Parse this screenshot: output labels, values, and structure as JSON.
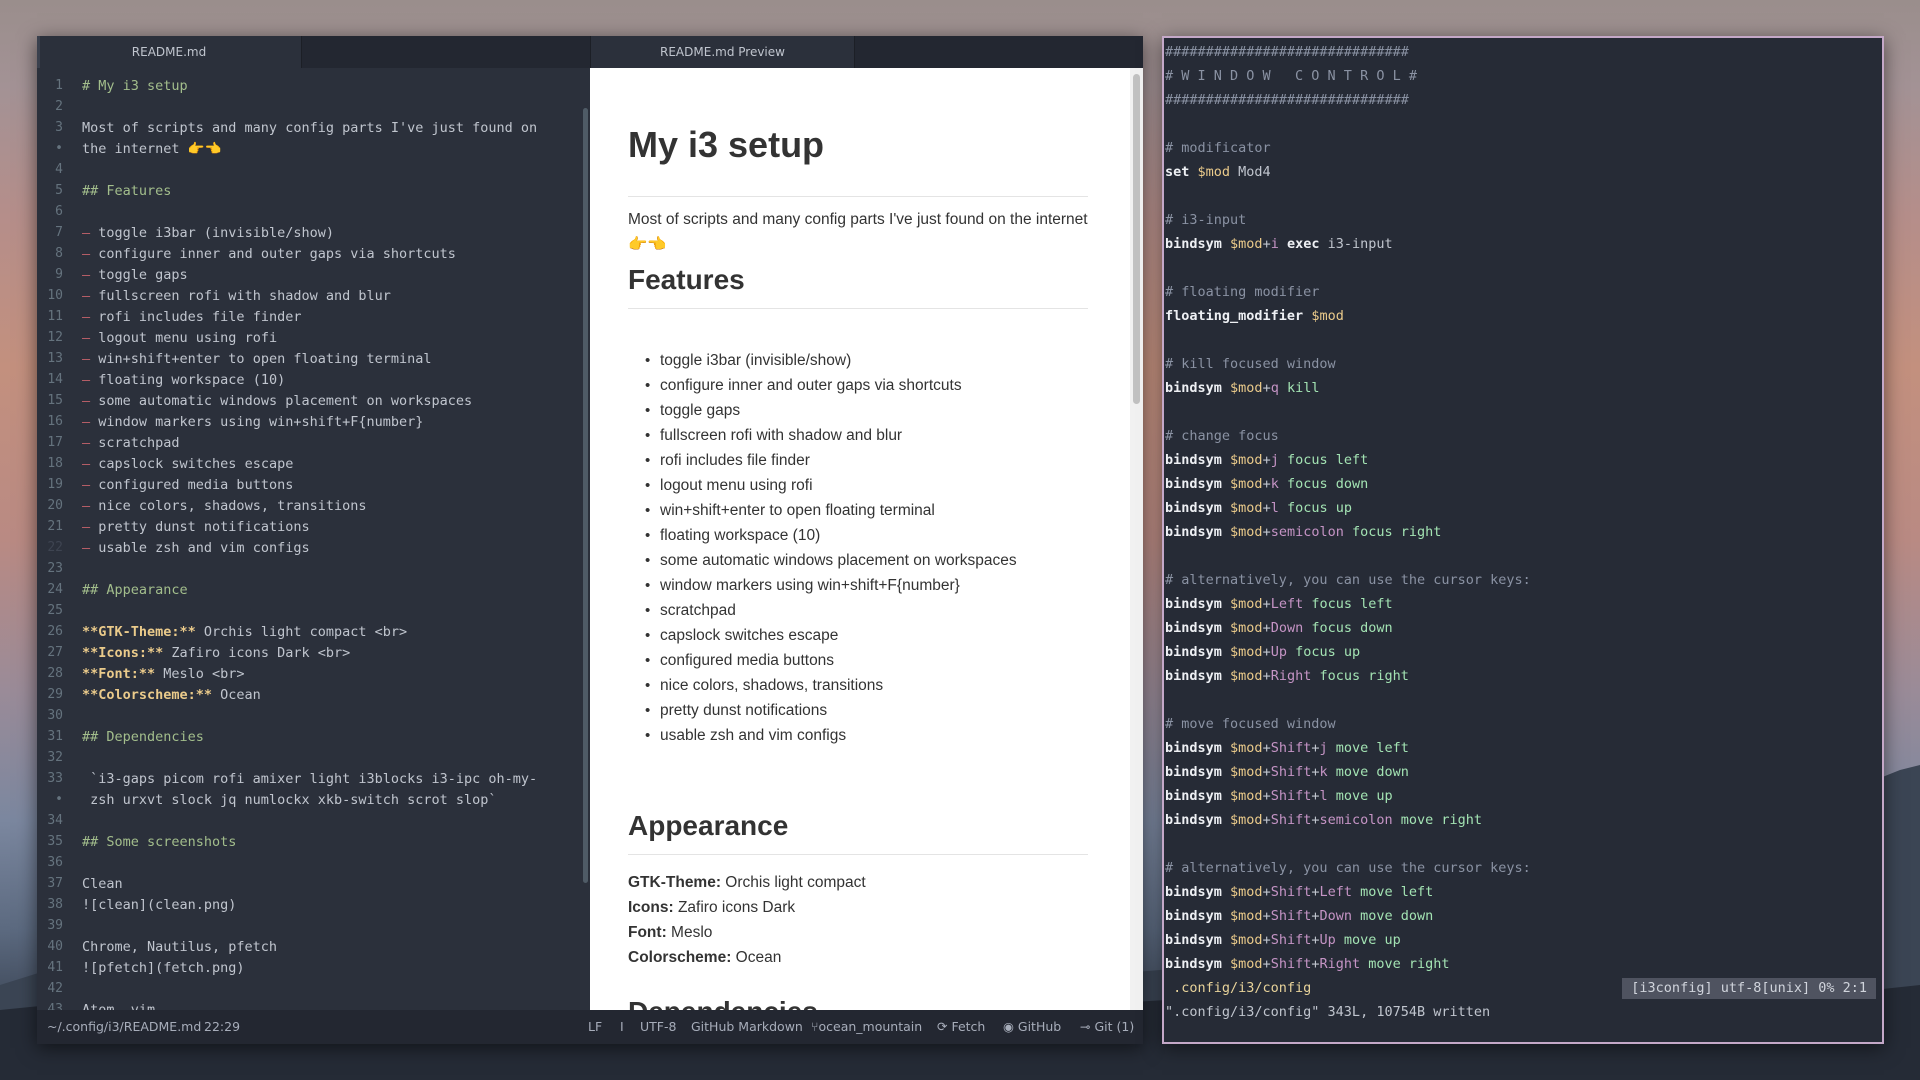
{
  "atom": {
    "tabs": [
      "README.md",
      "README.md Preview"
    ],
    "editor_lines": [
      {
        "n": "1",
        "text": "# My i3 setup",
        "kind": "h"
      },
      {
        "n": "2",
        "text": "",
        "kind": ""
      },
      {
        "n": "3",
        "text": "Most of scripts and many config parts I've just found on",
        "kind": ""
      },
      {
        "n": "•",
        "text": "the internet 👉👈",
        "kind": ""
      },
      {
        "n": "4",
        "text": "",
        "kind": ""
      },
      {
        "n": "5",
        "text": "## Features",
        "kind": "h"
      },
      {
        "n": "6",
        "text": "",
        "kind": ""
      },
      {
        "n": "7",
        "text": "toggle i3bar (invisible/show)",
        "kind": "li"
      },
      {
        "n": "8",
        "text": "configure inner and outer gaps via shortcuts",
        "kind": "li"
      },
      {
        "n": "9",
        "text": "toggle gaps",
        "kind": "li"
      },
      {
        "n": "10",
        "text": "fullscreen rofi with shadow and blur",
        "kind": "li"
      },
      {
        "n": "11",
        "text": "rofi includes file finder",
        "kind": "li"
      },
      {
        "n": "12",
        "text": "logout menu using rofi",
        "kind": "li"
      },
      {
        "n": "13",
        "text": "win+shift+enter to open floating terminal",
        "kind": "li"
      },
      {
        "n": "14",
        "text": "floating workspace (10)",
        "kind": "li"
      },
      {
        "n": "15",
        "text": "some automatic windows placement on workspaces",
        "kind": "li"
      },
      {
        "n": "16",
        "text": "window markers using win+shift+F{number}",
        "kind": "li"
      },
      {
        "n": "17",
        "text": "scratchpad",
        "kind": "li"
      },
      {
        "n": "18",
        "text": "capslock switches escape",
        "kind": "li"
      },
      {
        "n": "19",
        "text": "configured media buttons",
        "kind": "li"
      },
      {
        "n": "20",
        "text": "nice colors, shadows, transitions",
        "kind": "li"
      },
      {
        "n": "21",
        "text": "pretty dunst notifications",
        "kind": "li"
      },
      {
        "n": "22",
        "text": "usable zsh and vim configs",
        "kind": "li"
      },
      {
        "n": "23",
        "text": "",
        "kind": ""
      },
      {
        "n": "24",
        "text": "## Appearance",
        "kind": "h"
      },
      {
        "n": "25",
        "text": "",
        "kind": ""
      },
      {
        "n": "26",
        "bold": "**GTK-Theme:**",
        "text": " Orchis light compact <br>",
        "kind": "b"
      },
      {
        "n": "27",
        "bold": "**Icons:**",
        "text": " Zafiro icons Dark <br>",
        "kind": "b"
      },
      {
        "n": "28",
        "bold": "**Font:**",
        "text": " Meslo <br>",
        "kind": "b"
      },
      {
        "n": "29",
        "bold": "**Colorscheme:**",
        "text": " Ocean",
        "kind": "b"
      },
      {
        "n": "30",
        "text": "",
        "kind": ""
      },
      {
        "n": "31",
        "text": "## Dependencies",
        "kind": "h"
      },
      {
        "n": "32",
        "text": "",
        "kind": ""
      },
      {
        "n": "33",
        "text": " `i3-gaps picom rofi amixer light i3blocks i3-ipc oh-my-",
        "kind": ""
      },
      {
        "n": "•",
        "text": " zsh urxvt slock jq numlockx xkb-switch scrot slop`",
        "kind": ""
      },
      {
        "n": "34",
        "text": "",
        "kind": ""
      },
      {
        "n": "35",
        "text": "## Some screenshots",
        "kind": "h"
      },
      {
        "n": "36",
        "text": "",
        "kind": ""
      },
      {
        "n": "37",
        "text": "Clean",
        "kind": ""
      },
      {
        "n": "38",
        "text": "![clean](clean.png)",
        "kind": ""
      },
      {
        "n": "39",
        "text": "",
        "kind": ""
      },
      {
        "n": "40",
        "text": "Chrome, Nautilus, pfetch",
        "kind": ""
      },
      {
        "n": "41",
        "text": "![pfetch](fetch.png)",
        "kind": ""
      },
      {
        "n": "42",
        "text": "",
        "kind": ""
      },
      {
        "n": "43",
        "text": "Atom, vim",
        "kind": ""
      }
    ],
    "preview": {
      "title": "My i3 setup",
      "intro": "Most of scripts and many config parts I've just found on the internet 👉👈",
      "features_heading": "Features",
      "features": [
        "toggle i3bar (invisible/show)",
        "configure inner and outer gaps via shortcuts",
        "toggle gaps",
        "fullscreen rofi with shadow and blur",
        "rofi includes file finder",
        "logout menu using rofi",
        "win+shift+enter to open floating terminal",
        "floating workspace (10)",
        "some automatic windows placement on workspaces",
        "window markers using win+shift+F{number}",
        "scratchpad",
        "capslock switches escape",
        "configured media buttons",
        "nice colors, shadows, transitions",
        "pretty dunst notifications",
        "usable zsh and vim configs"
      ],
      "appearance_heading": "Appearance",
      "appearance": [
        {
          "key": "GTK-Theme:",
          "value": " Orchis light compact"
        },
        {
          "key": "Icons:",
          "value": " Zafiro icons Dark"
        },
        {
          "key": "Font:",
          "value": " Meslo"
        },
        {
          "key": "Colorscheme:",
          "value": " Ocean"
        }
      ],
      "dependencies_heading": "Dependencies"
    },
    "status": {
      "path": "~/.config/i3/README.md",
      "cursor": "22:29",
      "line_ending": "LF",
      "cursor_type": "I",
      "encoding": "UTF-8",
      "grammar": "GitHub Markdown",
      "branch_icon": "branch-icon",
      "branch": "ocean_mountain",
      "fetch_icon": "fetch-icon",
      "fetch": "Fetch",
      "github_icon": "github-icon",
      "github": "GitHub",
      "git_icon": "git-commit-icon",
      "git": "Git (1)"
    }
  },
  "terminal": {
    "lines": [
      [
        [
          "c",
          "##############################"
        ]
      ],
      [
        [
          "c",
          "# W I N D O W   C O N T R O L #"
        ]
      ],
      [
        [
          "c",
          "##############################"
        ]
      ],
      [],
      [
        [
          "c",
          "# modificator"
        ]
      ],
      [
        [
          "k",
          "set"
        ],
        [
          "",
          " "
        ],
        [
          "v",
          "$mod"
        ],
        [
          "",
          " Mod4"
        ]
      ],
      [],
      [
        [
          "c",
          "# i3-input"
        ]
      ],
      [
        [
          "k",
          "bindsym"
        ],
        [
          "",
          " "
        ],
        [
          "v",
          "$mod"
        ],
        [
          "",
          "+"
        ],
        [
          "m",
          "i"
        ],
        [
          "",
          " "
        ],
        [
          "k",
          "exec"
        ],
        [
          "",
          " i3-input"
        ]
      ],
      [],
      [
        [
          "c",
          "# floating modifier"
        ]
      ],
      [
        [
          "k",
          "floating_modifier"
        ],
        [
          "",
          " "
        ],
        [
          "v",
          "$mod"
        ]
      ],
      [],
      [
        [
          "c",
          "# kill focused window"
        ]
      ],
      [
        [
          "k",
          "bindsym"
        ],
        [
          "",
          " "
        ],
        [
          "v",
          "$mod"
        ],
        [
          "",
          "+"
        ],
        [
          "m",
          "q"
        ],
        [
          "",
          " "
        ],
        [
          "g",
          "kill"
        ]
      ],
      [],
      [
        [
          "c",
          "# change focus"
        ]
      ],
      [
        [
          "k",
          "bindsym"
        ],
        [
          "",
          " "
        ],
        [
          "v",
          "$mod"
        ],
        [
          "",
          "+"
        ],
        [
          "m",
          "j"
        ],
        [
          "",
          " "
        ],
        [
          "g",
          "focus left"
        ]
      ],
      [
        [
          "k",
          "bindsym"
        ],
        [
          "",
          " "
        ],
        [
          "v",
          "$mod"
        ],
        [
          "",
          "+"
        ],
        [
          "m",
          "k"
        ],
        [
          "",
          " "
        ],
        [
          "g",
          "focus down"
        ]
      ],
      [
        [
          "k",
          "bindsym"
        ],
        [
          "",
          " "
        ],
        [
          "v",
          "$mod"
        ],
        [
          "",
          "+"
        ],
        [
          "m",
          "l"
        ],
        [
          "",
          " "
        ],
        [
          "g",
          "focus up"
        ]
      ],
      [
        [
          "k",
          "bindsym"
        ],
        [
          "",
          " "
        ],
        [
          "v",
          "$mod"
        ],
        [
          "",
          "+"
        ],
        [
          "m",
          "semicolon"
        ],
        [
          "",
          " "
        ],
        [
          "g",
          "focus right"
        ]
      ],
      [],
      [
        [
          "c",
          "# alternatively, you can use the cursor keys:"
        ]
      ],
      [
        [
          "k",
          "bindsym"
        ],
        [
          "",
          " "
        ],
        [
          "v",
          "$mod"
        ],
        [
          "",
          "+"
        ],
        [
          "m",
          "Left"
        ],
        [
          "",
          " "
        ],
        [
          "g",
          "focus left"
        ]
      ],
      [
        [
          "k",
          "bindsym"
        ],
        [
          "",
          " "
        ],
        [
          "v",
          "$mod"
        ],
        [
          "",
          "+"
        ],
        [
          "m",
          "Down"
        ],
        [
          "",
          " "
        ],
        [
          "g",
          "focus down"
        ]
      ],
      [
        [
          "k",
          "bindsym"
        ],
        [
          "",
          " "
        ],
        [
          "v",
          "$mod"
        ],
        [
          "",
          "+"
        ],
        [
          "m",
          "Up"
        ],
        [
          "",
          " "
        ],
        [
          "g",
          "focus up"
        ]
      ],
      [
        [
          "k",
          "bindsym"
        ],
        [
          "",
          " "
        ],
        [
          "v",
          "$mod"
        ],
        [
          "",
          "+"
        ],
        [
          "m",
          "Right"
        ],
        [
          "",
          " "
        ],
        [
          "g",
          "focus right"
        ]
      ],
      [],
      [
        [
          "c",
          "# move focused window"
        ]
      ],
      [
        [
          "k",
          "bindsym"
        ],
        [
          "",
          " "
        ],
        [
          "v",
          "$mod"
        ],
        [
          "",
          "+"
        ],
        [
          "m",
          "Shift"
        ],
        [
          "",
          "+"
        ],
        [
          "m",
          "j"
        ],
        [
          "",
          " "
        ],
        [
          "g",
          "move left"
        ]
      ],
      [
        [
          "k",
          "bindsym"
        ],
        [
          "",
          " "
        ],
        [
          "v",
          "$mod"
        ],
        [
          "",
          "+"
        ],
        [
          "m",
          "Shift"
        ],
        [
          "",
          "+"
        ],
        [
          "m",
          "k"
        ],
        [
          "",
          " "
        ],
        [
          "g",
          "move down"
        ]
      ],
      [
        [
          "k",
          "bindsym"
        ],
        [
          "",
          " "
        ],
        [
          "v",
          "$mod"
        ],
        [
          "",
          "+"
        ],
        [
          "m",
          "Shift"
        ],
        [
          "",
          "+"
        ],
        [
          "m",
          "l"
        ],
        [
          "",
          " "
        ],
        [
          "g",
          "move up"
        ]
      ],
      [
        [
          "k",
          "bindsym"
        ],
        [
          "",
          " "
        ],
        [
          "v",
          "$mod"
        ],
        [
          "",
          "+"
        ],
        [
          "m",
          "Shift"
        ],
        [
          "",
          "+"
        ],
        [
          "m",
          "semicolon"
        ],
        [
          "",
          " "
        ],
        [
          "g",
          "move right"
        ]
      ],
      [],
      [
        [
          "c",
          "# alternatively, you can use the cursor keys:"
        ]
      ],
      [
        [
          "k",
          "bindsym"
        ],
        [
          "",
          " "
        ],
        [
          "v",
          "$mod"
        ],
        [
          "",
          "+"
        ],
        [
          "m",
          "Shift"
        ],
        [
          "",
          "+"
        ],
        [
          "m",
          "Left"
        ],
        [
          "",
          " "
        ],
        [
          "g",
          "move left"
        ]
      ],
      [
        [
          "k",
          "bindsym"
        ],
        [
          "",
          " "
        ],
        [
          "v",
          "$mod"
        ],
        [
          "",
          "+"
        ],
        [
          "m",
          "Shift"
        ],
        [
          "",
          "+"
        ],
        [
          "m",
          "Down"
        ],
        [
          "",
          " "
        ],
        [
          "g",
          "move down"
        ]
      ],
      [
        [
          "k",
          "bindsym"
        ],
        [
          "",
          " "
        ],
        [
          "v",
          "$mod"
        ],
        [
          "",
          "+"
        ],
        [
          "m",
          "Shift"
        ],
        [
          "",
          "+"
        ],
        [
          "m",
          "Up"
        ],
        [
          "",
          " "
        ],
        [
          "g",
          "move up"
        ]
      ],
      [
        [
          "k",
          "bindsym"
        ],
        [
          "",
          " "
        ],
        [
          "v",
          "$mod"
        ],
        [
          "",
          "+"
        ],
        [
          "m",
          "Shift"
        ],
        [
          "",
          "+"
        ],
        [
          "m",
          "Right"
        ],
        [
          "",
          " "
        ],
        [
          "g",
          "move right"
        ]
      ],
      [
        [
          "y",
          " .config/i3/config"
        ]
      ],
      [
        [
          "",
          "\".config/i3/config\" 343L, 10754B written"
        ]
      ]
    ],
    "vim_status": "[i3config] utf-8[unix] 0% 2:1"
  },
  "colors": {
    "editor_bg": "#2b303b",
    "terminal_border": "#c4a8c8",
    "heading_green": "#a3be8c",
    "dash_red": "#bf616a",
    "bold_yellow": "#ebcb8b"
  }
}
